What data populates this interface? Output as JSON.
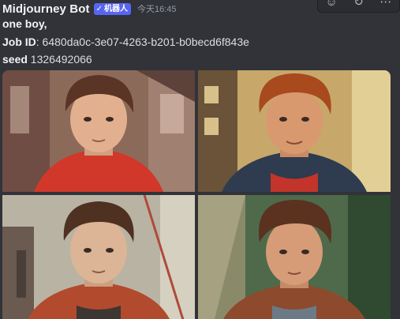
{
  "message": {
    "username": "Midjourney Bot",
    "bot_tag": {
      "check": "✓",
      "label": "机器人"
    },
    "timestamp": "今天16:45",
    "prompt": "one boy,",
    "job_id_label": "Job ID",
    "job_id_value": ": 6480da0c-3e07-4263-b201-b0becd6f843e",
    "seed_label": "seed",
    "seed_value": " 1326492066"
  },
  "toolbar": {
    "icons": [
      "reaction-icon",
      "refresh-icon",
      "more-icon"
    ]
  },
  "image_grid": {
    "tiles": [
      {
        "name": "image-1",
        "background": "#8c6a5a",
        "shirt": "#d1382a",
        "hair": "#5a3424",
        "skin": "#e3b08f"
      },
      {
        "name": "image-2",
        "background": "#c7a86a",
        "shirt": "#2f3b4f",
        "hair": "#a8491e",
        "skin": "#d9996f"
      },
      {
        "name": "image-3",
        "background": "#b9b3a4",
        "shirt": "#b24a2e",
        "hair": "#4e3121",
        "skin": "#dcb496"
      },
      {
        "name": "image-4",
        "background": "#4f6a4a",
        "shirt": "#8e4a2c",
        "hair": "#5b321f",
        "skin": "#d69c78"
      }
    ]
  },
  "colors": {
    "background": "#313338",
    "bot_tag": "#5865f2",
    "text": "#dbdee1",
    "muted": "#949ba4"
  }
}
